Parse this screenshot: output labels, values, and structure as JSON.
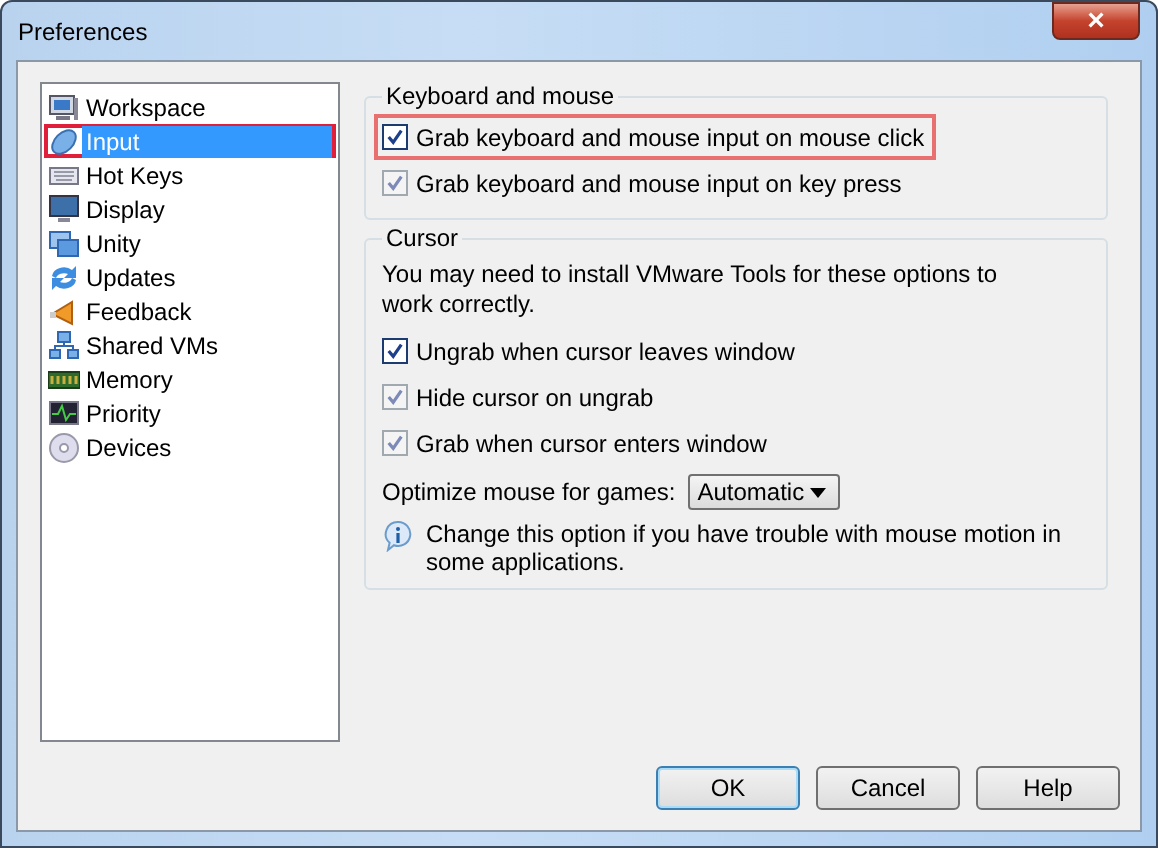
{
  "window": {
    "title": "Preferences",
    "close": "×"
  },
  "sidebar": {
    "items": [
      {
        "label": "Workspace",
        "selected": false,
        "highlighted": false
      },
      {
        "label": "Input",
        "selected": true,
        "highlighted": true
      },
      {
        "label": "Hot Keys",
        "selected": false,
        "highlighted": false
      },
      {
        "label": "Display",
        "selected": false,
        "highlighted": false
      },
      {
        "label": "Unity",
        "selected": false,
        "highlighted": false
      },
      {
        "label": "Updates",
        "selected": false,
        "highlighted": false
      },
      {
        "label": "Feedback",
        "selected": false,
        "highlighted": false
      },
      {
        "label": "Shared VMs",
        "selected": false,
        "highlighted": false
      },
      {
        "label": "Memory",
        "selected": false,
        "highlighted": false
      },
      {
        "label": "Priority",
        "selected": false,
        "highlighted": false
      },
      {
        "label": "Devices",
        "selected": false,
        "highlighted": false
      }
    ]
  },
  "keyboard_and_mouse": {
    "title": "Keyboard and mouse",
    "options": [
      {
        "label": "Grab keyboard and mouse input on mouse click",
        "checked": true,
        "disabled": false,
        "highlighted": true
      },
      {
        "label": "Grab keyboard and mouse input on key press",
        "checked": true,
        "disabled": true,
        "highlighted": false
      }
    ]
  },
  "cursor": {
    "title": "Cursor",
    "note": "You may need to install VMware Tools for these options to work correctly.",
    "options": [
      {
        "label": "Ungrab when cursor leaves window",
        "checked": true,
        "disabled": false,
        "highlighted": false
      },
      {
        "label": "Hide cursor on ungrab",
        "checked": true,
        "disabled": true,
        "highlighted": false
      },
      {
        "label": "Grab when cursor enters window",
        "checked": true,
        "disabled": true,
        "highlighted": false
      }
    ],
    "optimize_label": "Optimize mouse for games:",
    "optimize_value": "Automatic",
    "info": "Change this option if you have trouble with mouse motion in some applications."
  },
  "buttons": [
    {
      "label": "OK",
      "default": true
    },
    {
      "label": "Cancel",
      "default": false
    },
    {
      "label": "Help",
      "default": false
    }
  ]
}
